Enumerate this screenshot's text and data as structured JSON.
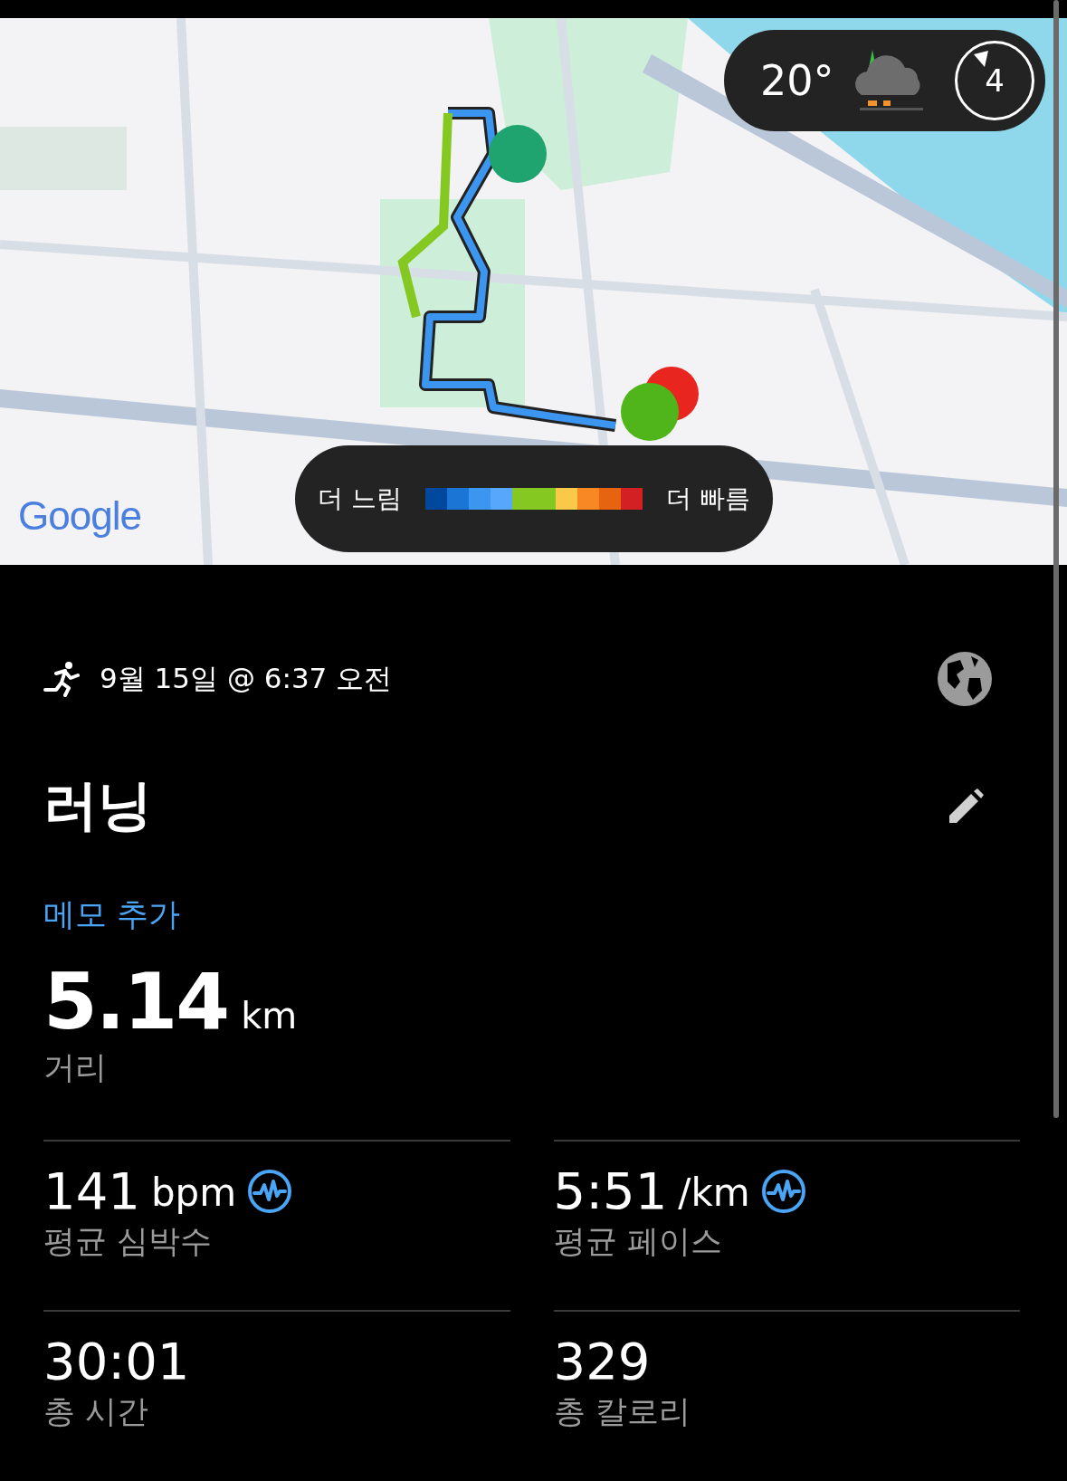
{
  "map": {
    "kind": "picture",
    "weather": {
      "temperature": "20°",
      "wind": "4"
    },
    "legend": {
      "slow_label": "더 느림",
      "fast_label": "더 빠름",
      "swatches": [
        {
          "color": "#00479e"
        },
        {
          "color": "#1b75d4"
        },
        {
          "color": "#3c96ef"
        },
        {
          "color": "#57a8fc"
        },
        {
          "color": "#84c821"
        },
        {
          "color": "#84c821"
        },
        {
          "color": "#fbc94a"
        },
        {
          "color": "#f78824"
        },
        {
          "color": "#e6630f"
        },
        {
          "color": "#d32023"
        }
      ]
    },
    "attribution": "Google"
  },
  "activity": {
    "datetime": "9월 15일 @ 6:37 오전",
    "title": "러닝",
    "memo_link": "메모 추가"
  },
  "distance": {
    "value": "5.14",
    "unit": "km",
    "label": "거리"
  },
  "stats": [
    {
      "value": "141",
      "unit": "bpm",
      "label": "평균 심박수",
      "has_chart_icon": true
    },
    {
      "value": "5:51",
      "unit": "/km",
      "label": "평균 페이스",
      "has_chart_icon": true
    },
    {
      "value": "30:01",
      "label": "총 시간",
      "has_chart_icon": false
    },
    {
      "value": "329",
      "label": "총 칼로리",
      "has_chart_icon": false
    }
  ]
}
